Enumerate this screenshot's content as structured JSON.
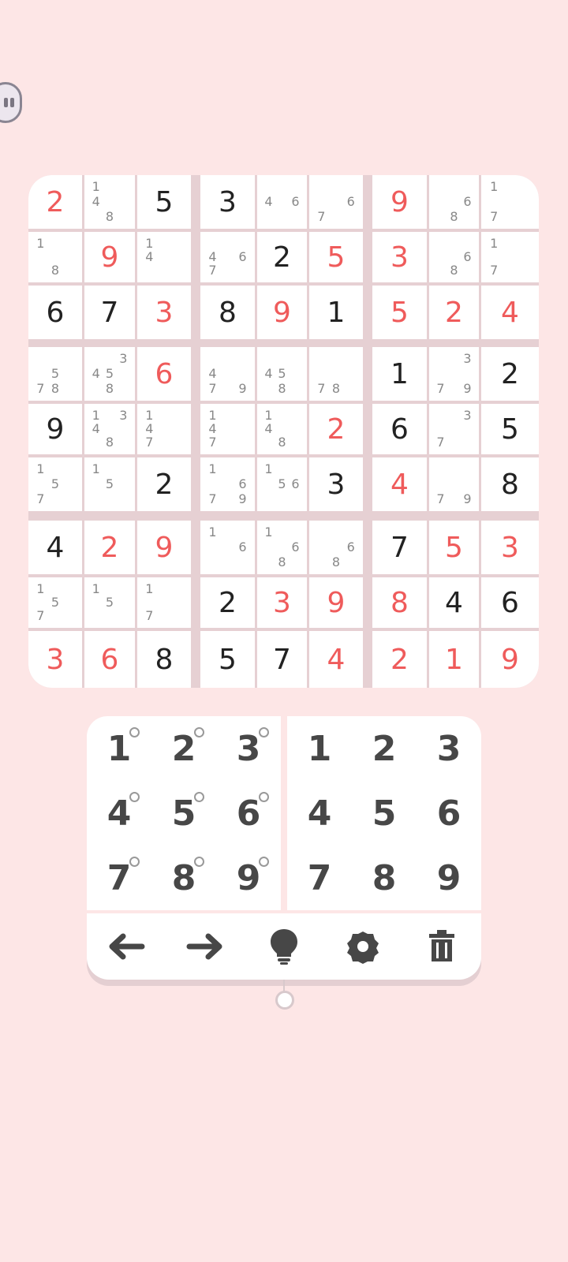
{
  "colors": {
    "background": "#fde6e6",
    "given": "#222222",
    "entered": "#ef5b5b",
    "note": "#888888"
  },
  "grid": [
    [
      {
        "v": "2",
        "red": true
      },
      {
        "n": [
          "1",
          "4",
          "8"
        ]
      },
      {
        "v": "5"
      },
      {
        "v": "3"
      },
      {
        "n": [
          "4",
          "6"
        ]
      },
      {
        "n": [
          "6",
          "7"
        ]
      },
      {
        "v": "9",
        "red": true
      },
      {
        "n": [
          "6",
          "8"
        ]
      },
      {
        "n": [
          "1",
          "7"
        ]
      }
    ],
    [
      {
        "n": [
          "1",
          "8"
        ]
      },
      {
        "v": "9",
        "red": true
      },
      {
        "n": [
          "1",
          "4"
        ]
      },
      {
        "n": [
          "4",
          "6",
          "7"
        ]
      },
      {
        "v": "2"
      },
      {
        "v": "5",
        "red": true
      },
      {
        "v": "3",
        "red": true
      },
      {
        "n": [
          "6",
          "8"
        ]
      },
      {
        "n": [
          "1",
          "7"
        ]
      }
    ],
    [
      {
        "v": "6"
      },
      {
        "v": "7"
      },
      {
        "v": "3",
        "red": true
      },
      {
        "v": "8"
      },
      {
        "v": "9",
        "red": true
      },
      {
        "v": "1"
      },
      {
        "v": "5",
        "red": true
      },
      {
        "v": "2",
        "red": true
      },
      {
        "v": "4",
        "red": true
      }
    ],
    [
      {
        "n": [
          "5",
          "7",
          "8"
        ]
      },
      {
        "n": [
          "3",
          "4",
          "5",
          "8"
        ]
      },
      {
        "v": "6",
        "red": true
      },
      {
        "n": [
          "4",
          "7",
          "9"
        ]
      },
      {
        "n": [
          "4",
          "5",
          "8"
        ]
      },
      {
        "n": [
          "7",
          "8"
        ]
      },
      {
        "v": "1"
      },
      {
        "n": [
          "3",
          "7",
          "9"
        ]
      },
      {
        "v": "2"
      }
    ],
    [
      {
        "v": "9"
      },
      {
        "n": [
          "1",
          "3",
          "4",
          "8"
        ]
      },
      {
        "n": [
          "1",
          "4",
          "7"
        ]
      },
      {
        "n": [
          "1",
          "4",
          "7"
        ]
      },
      {
        "n": [
          "1",
          "4",
          "8"
        ]
      },
      {
        "v": "2",
        "red": true
      },
      {
        "v": "6"
      },
      {
        "n": [
          "3",
          "7"
        ]
      },
      {
        "v": "5"
      }
    ],
    [
      {
        "n": [
          "1",
          "5",
          "7"
        ]
      },
      {
        "n": [
          "1",
          "5"
        ]
      },
      {
        "v": "2"
      },
      {
        "n": [
          "1",
          "6",
          "7",
          "9"
        ]
      },
      {
        "n": [
          "1",
          "5",
          "6"
        ]
      },
      {
        "v": "3"
      },
      {
        "v": "4",
        "red": true
      },
      {
        "n": [
          "7",
          "9"
        ]
      },
      {
        "v": "8"
      }
    ],
    [
      {
        "v": "4"
      },
      {
        "v": "2",
        "red": true
      },
      {
        "v": "9",
        "red": true
      },
      {
        "n": [
          "1",
          "6"
        ]
      },
      {
        "n": [
          "1",
          "6",
          "8"
        ]
      },
      {
        "n": [
          "6",
          "8"
        ]
      },
      {
        "v": "7"
      },
      {
        "v": "5",
        "red": true
      },
      {
        "v": "3",
        "red": true
      }
    ],
    [
      {
        "n": [
          "1",
          "5",
          "7"
        ]
      },
      {
        "n": [
          "1",
          "5"
        ]
      },
      {
        "n": [
          "1",
          "7"
        ]
      },
      {
        "v": "2"
      },
      {
        "v": "3",
        "red": true
      },
      {
        "v": "9",
        "red": true
      },
      {
        "v": "8",
        "red": true
      },
      {
        "v": "4"
      },
      {
        "v": "6"
      }
    ],
    [
      {
        "v": "3",
        "red": true
      },
      {
        "v": "6",
        "red": true
      },
      {
        "v": "8"
      },
      {
        "v": "5"
      },
      {
        "v": "7"
      },
      {
        "v": "4",
        "red": true
      },
      {
        "v": "2",
        "red": true
      },
      {
        "v": "1",
        "red": true
      },
      {
        "v": "9",
        "red": true
      }
    ]
  ],
  "notes_pad": [
    "1",
    "2",
    "3",
    "4",
    "5",
    "6",
    "7",
    "8",
    "9"
  ],
  "number_pad": [
    "1",
    "2",
    "3",
    "4",
    "5",
    "6",
    "7",
    "8",
    "9"
  ],
  "toolbar": {
    "icons": [
      "arrow-left-icon",
      "arrow-right-icon",
      "lightbulb-icon",
      "gear-icon",
      "trash-icon"
    ]
  }
}
